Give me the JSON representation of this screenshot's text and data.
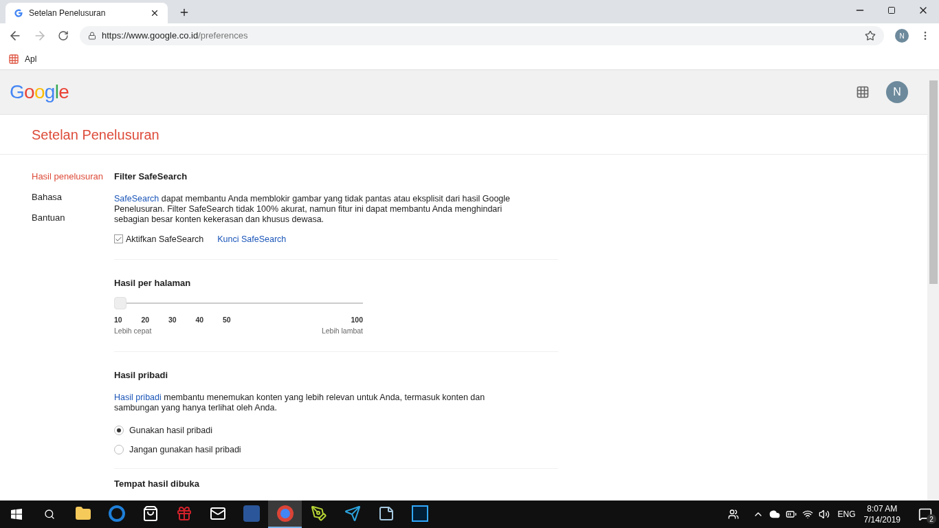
{
  "browser": {
    "tab_title": "Setelan Penelusuran",
    "url_host": "https://www.google.co.id",
    "url_path": "/preferences",
    "avatar": "N",
    "bookmark": "Apl"
  },
  "header": {
    "logo": "Google",
    "avatar": "N"
  },
  "page_title": "Setelan Penelusuran",
  "sidebar": [
    {
      "label": "Hasil penelusuran",
      "selected": true
    },
    {
      "label": "Bahasa",
      "selected": false
    },
    {
      "label": "Bantuan",
      "selected": false
    }
  ],
  "safesearch": {
    "heading": "Filter SafeSearch",
    "link": "SafeSearch",
    "text": " dapat membantu Anda memblokir gambar yang tidak pantas atau eksplisit dari hasil Google Penelusuran. Filter SafeSearch tidak 100% akurat, namun fitur ini dapat membantu Anda menghindari sebagian besar konten kekerasan dan khusus dewasa.",
    "checkbox": {
      "label": "Aktifkan SafeSearch",
      "checked": true
    },
    "lock_link": "Kunci SafeSearch"
  },
  "results_per_page": {
    "heading": "Hasil per halaman",
    "level": 0,
    "ticks": [
      "10",
      "20",
      "30",
      "40",
      "50",
      "100"
    ],
    "left_label": "Lebih cepat",
    "right_label": "Lebih lambat"
  },
  "private_results": {
    "heading": "Hasil pribadi",
    "link": "Hasil pribadi",
    "text": " membantu menemukan konten yang lebih relevan untuk Anda, termasuk konten dan sambungan yang hanya terlihat oleh Anda.",
    "options": [
      {
        "label": "Gunakan hasil pribadi",
        "selected": true
      },
      {
        "label": "Jangan gunakan hasil pribadi",
        "selected": false
      }
    ]
  },
  "next_heading": "Tempat hasil dibuka",
  "taskbar": {
    "apps": [
      {
        "kind": "folder",
        "active": false
      },
      {
        "kind": "edge",
        "active": false
      },
      {
        "kind": "store",
        "active": false
      },
      {
        "kind": "gift",
        "active": false
      },
      {
        "kind": "mail",
        "active": false
      },
      {
        "kind": "word",
        "active": false
      },
      {
        "kind": "chrome",
        "active": true
      },
      {
        "kind": "pen",
        "active": false
      },
      {
        "kind": "telegram",
        "active": false
      },
      {
        "kind": "notes",
        "active": false
      },
      {
        "kind": "ps",
        "active": false
      }
    ],
    "language": "ENG",
    "time": "8:07 AM",
    "date": "7/14/2019",
    "notifications": "2"
  }
}
